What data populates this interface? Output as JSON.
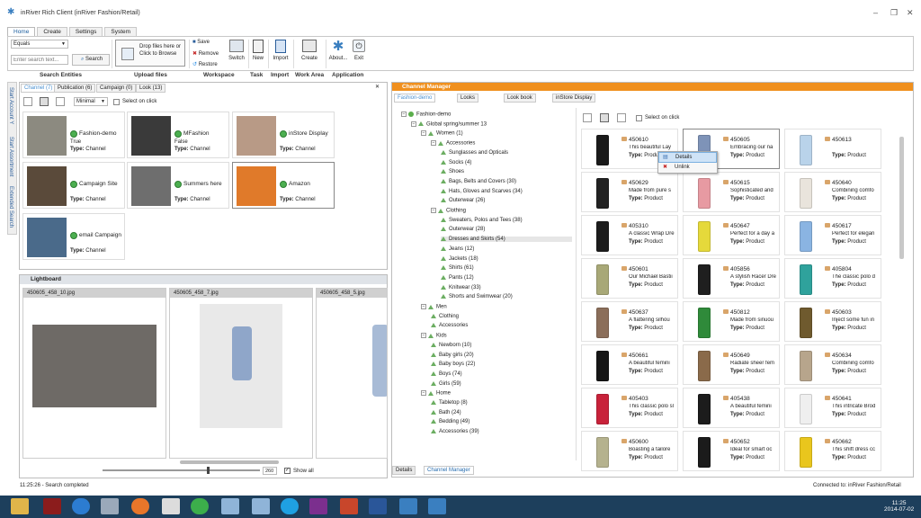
{
  "window": {
    "title": "inRiver Rich Client (inRiver Fashion/Retail)"
  },
  "ribbon": {
    "tabs": [
      "Home",
      "Create",
      "Settings",
      "System"
    ],
    "active_tab": "Home",
    "search_mode": "Equals",
    "search_placeholder": "Enter search text...",
    "search_button": "Search",
    "upload_text": "Drop files here or Click to Browse",
    "workspace": {
      "save": "Save",
      "remove": "Remove",
      "restore": "Restore",
      "switch": "Switch"
    },
    "task": {
      "new": "New"
    },
    "import": {
      "import": "Import"
    },
    "workarea": {
      "create": "Create"
    },
    "application": {
      "about": "About...",
      "exit": "Exit"
    },
    "groups": [
      "Search Entities",
      "Upload files",
      "Workspace",
      "Task",
      "Import",
      "Work Area",
      "Application"
    ]
  },
  "sidetabs": [
    "Start Account Y",
    "Start Assortment",
    "Extended Search"
  ],
  "workarea": {
    "tabs": [
      "Channel (7)",
      "Publication (6)",
      "Campaign (0)",
      "Look (13)"
    ],
    "view_mode": "Minimal",
    "select_on_click": "Select on click",
    "cards": [
      {
        "name": "Fashion-demo",
        "line2": "True",
        "type_label": "Type:",
        "type": "Channel"
      },
      {
        "name": "MFashion",
        "line2": "False",
        "type_label": "Type:",
        "type": "Channel"
      },
      {
        "name": "inStore Display",
        "line2": "",
        "type_label": "Type:",
        "type": "Channel"
      },
      {
        "name": "Campaign Site",
        "line2": "",
        "type_label": "Type:",
        "type": "Channel"
      },
      {
        "name": "Summers here",
        "line2": "",
        "type_label": "Type:",
        "type": "Channel"
      },
      {
        "name": "Amazon",
        "line2": "",
        "type_label": "Type:",
        "type": "Channel"
      },
      {
        "name": "email Campaign",
        "line2": "",
        "type_label": "Type:",
        "type": "Channel"
      }
    ]
  },
  "lightboard": {
    "title": "Lightboard",
    "images": [
      "450605_458_10.jpg",
      "450605_458_7.jpg",
      "450605_458_5.jpg"
    ],
    "slider_value": "260",
    "show_all": "Show all"
  },
  "status": {
    "left": "11:25:26 - Search completed",
    "right": "Connected to: inRiver Fashion/Retail"
  },
  "channel_manager": {
    "title": "Channel Manager",
    "tabs": [
      "Fashion-demo",
      "Looks",
      "Look book",
      "inStore Display"
    ],
    "select_on_click": "Select on click",
    "tree": [
      {
        "label": "Fashion-demo",
        "level": 0,
        "kind": "root"
      },
      {
        "label": "Global spring/summer 13",
        "level": 1,
        "kind": "node"
      },
      {
        "label": "Women (1)",
        "level": 2,
        "kind": "node"
      },
      {
        "label": "Accessories",
        "level": 3,
        "kind": "node"
      },
      {
        "label": "Sunglasses and Opticals",
        "level": 4,
        "kind": "leaf"
      },
      {
        "label": "Socks (4)",
        "level": 4,
        "kind": "leaf"
      },
      {
        "label": "Shoes",
        "level": 4,
        "kind": "leaf"
      },
      {
        "label": "Bags, Belts and Covers (30)",
        "level": 4,
        "kind": "leaf"
      },
      {
        "label": "Hats, Gloves and Scarves (34)",
        "level": 4,
        "kind": "leaf"
      },
      {
        "label": "Outerwear (26)",
        "level": 4,
        "kind": "leaf"
      },
      {
        "label": "Clothing",
        "level": 3,
        "kind": "node"
      },
      {
        "label": "Sweaters, Polos and Tees (38)",
        "level": 4,
        "kind": "leaf"
      },
      {
        "label": "Outerwear (28)",
        "level": 4,
        "kind": "leaf"
      },
      {
        "label": "Dresses and Skirts (54)",
        "level": 4,
        "kind": "leaf",
        "selected": true
      },
      {
        "label": "Jeans (12)",
        "level": 4,
        "kind": "leaf"
      },
      {
        "label": "Jackets (18)",
        "level": 4,
        "kind": "leaf"
      },
      {
        "label": "Shirts (61)",
        "level": 4,
        "kind": "leaf"
      },
      {
        "label": "Pants (12)",
        "level": 4,
        "kind": "leaf"
      },
      {
        "label": "Knitwear (33)",
        "level": 4,
        "kind": "leaf"
      },
      {
        "label": "Shorts and Swimwear (20)",
        "level": 4,
        "kind": "leaf"
      },
      {
        "label": "Men",
        "level": 2,
        "kind": "node"
      },
      {
        "label": "Clothing",
        "level": 3,
        "kind": "leaf"
      },
      {
        "label": "Accessories",
        "level": 3,
        "kind": "leaf"
      },
      {
        "label": "Kids",
        "level": 2,
        "kind": "node"
      },
      {
        "label": "Newborn (10)",
        "level": 3,
        "kind": "leaf"
      },
      {
        "label": "Baby girls (20)",
        "level": 3,
        "kind": "leaf"
      },
      {
        "label": "Baby boys (22)",
        "level": 3,
        "kind": "leaf"
      },
      {
        "label": "Boys (74)",
        "level": 3,
        "kind": "leaf"
      },
      {
        "label": "Girls (59)",
        "level": 3,
        "kind": "leaf"
      },
      {
        "label": "Home",
        "level": 2,
        "kind": "node"
      },
      {
        "label": "Tabletop (8)",
        "level": 3,
        "kind": "leaf"
      },
      {
        "label": "Bath (24)",
        "level": 3,
        "kind": "leaf"
      },
      {
        "label": "Bedding (49)",
        "level": 3,
        "kind": "leaf"
      },
      {
        "label": "Accessories (39)",
        "level": 3,
        "kind": "leaf"
      }
    ],
    "type_label": "Type:",
    "products": [
      {
        "id": "450610",
        "desc": "This beautiful Lay",
        "type": "Product",
        "color": "#1a1a1a"
      },
      {
        "id": "450605",
        "desc": "Embracing our na",
        "type": "Product",
        "color": "#7e93b8"
      },
      {
        "id": "450613",
        "desc": "",
        "type": "Product",
        "color": "#b9d3ea"
      },
      {
        "id": "450629",
        "desc": "Made from pure s",
        "type": "Product",
        "color": "#222"
      },
      {
        "id": "450615",
        "desc": "Sophisticated and",
        "type": "Product",
        "color": "#e79aa2"
      },
      {
        "id": "450640",
        "desc": "Combining comfo",
        "type": "Product",
        "color": "#e9e4dc"
      },
      {
        "id": "405310",
        "desc": "A classic Wrap Dre",
        "type": "Product",
        "color": "#1c1c1c"
      },
      {
        "id": "450647",
        "desc": "Perfect for a day a",
        "type": "Product",
        "color": "#e5d93b"
      },
      {
        "id": "450617",
        "desc": "Perfect for elegan",
        "type": "Product",
        "color": "#8ab4e2"
      },
      {
        "id": "450601",
        "desc": "Our Michael Bastii",
        "type": "Product",
        "color": "#a8a877"
      },
      {
        "id": "405856",
        "desc": "A stylish Racer Dre",
        "type": "Product",
        "color": "#1f1f1f"
      },
      {
        "id": "405804",
        "desc": "The classic polo d",
        "type": "Product",
        "color": "#2fa29c"
      },
      {
        "id": "450637",
        "desc": "A flattering silhou",
        "type": "Product",
        "color": "#8b6e5a"
      },
      {
        "id": "450812",
        "desc": "Made from sinuou",
        "type": "Product",
        "color": "#2f8a3a"
      },
      {
        "id": "450603",
        "desc": "Inject some fun in",
        "type": "Product",
        "color": "#6f5a2e"
      },
      {
        "id": "450661",
        "desc": "A beautiful femini",
        "type": "Product",
        "color": "#161616"
      },
      {
        "id": "450649",
        "desc": "Radiate sheer fem",
        "type": "Product",
        "color": "#8a6a4a"
      },
      {
        "id": "450634",
        "desc": "Combining comfo",
        "type": "Product",
        "color": "#b7a58c"
      },
      {
        "id": "405403",
        "desc": "This classic polo sl",
        "type": "Product",
        "color": "#c8223a"
      },
      {
        "id": "405438",
        "desc": "A beautiful femini",
        "type": "Product",
        "color": "#1c1c1c"
      },
      {
        "id": "450641",
        "desc": "This intricate Brod",
        "type": "Product",
        "color": "#efefef"
      },
      {
        "id": "450600",
        "desc": "Boasting a tailore",
        "type": "Product",
        "color": "#b5b28e"
      },
      {
        "id": "450652",
        "desc": "Ideal for smart oc",
        "type": "Product",
        "color": "#1b1b1b"
      },
      {
        "id": "450662",
        "desc": "This shift dress cc",
        "type": "Product",
        "color": "#e9c61d"
      }
    ],
    "context_menu": [
      "Details",
      "Unlink"
    ],
    "bottom_tabs": [
      "Details",
      "Channel Manager"
    ]
  },
  "taskbar": {
    "time": "11:25",
    "date": "2014-07-02"
  }
}
